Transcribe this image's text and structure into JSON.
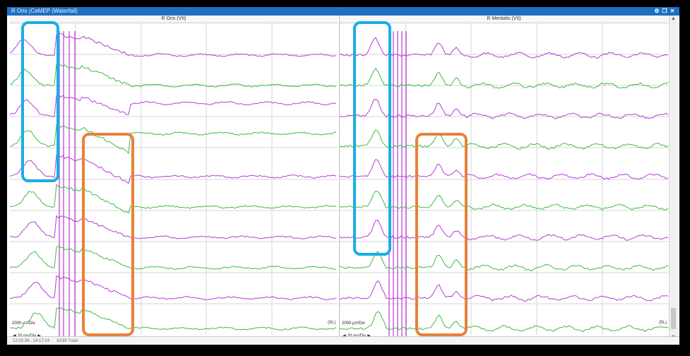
{
  "window": {
    "title": "R Oris (CeMEP (Waterfall)",
    "controls": [
      "gear-icon",
      "restore-icon",
      "close-icon"
    ]
  },
  "panes": [
    {
      "id": "left",
      "header": "R Oris (VII)",
      "scale": "2000 μV/Div",
      "timebase": "20 ms/Div",
      "baseline_marker": "(BL)"
    },
    {
      "id": "right",
      "header": "R Mentalis (VII)",
      "scale": "2000 μV/Div",
      "timebase": "20 ms/Div",
      "baseline_marker": "(BL)"
    }
  ],
  "status": {
    "time_range": "12:02:39 - 14:17:24",
    "trials": "10/35 Trials"
  },
  "colors": {
    "trace_purple": "#b93ad6",
    "trace_green": "#3dbb3d",
    "highlight_blue": "#18aee6",
    "highlight_orange": "#e8823a",
    "titlebar": "#1e6fbf"
  },
  "highlights": [
    {
      "pane": "left",
      "color": "blue",
      "label": ""
    },
    {
      "pane": "left",
      "color": "orange",
      "label": ""
    },
    {
      "pane": "right",
      "color": "blue",
      "label": ""
    },
    {
      "pane": "right",
      "color": "orange",
      "label": ""
    }
  ]
}
